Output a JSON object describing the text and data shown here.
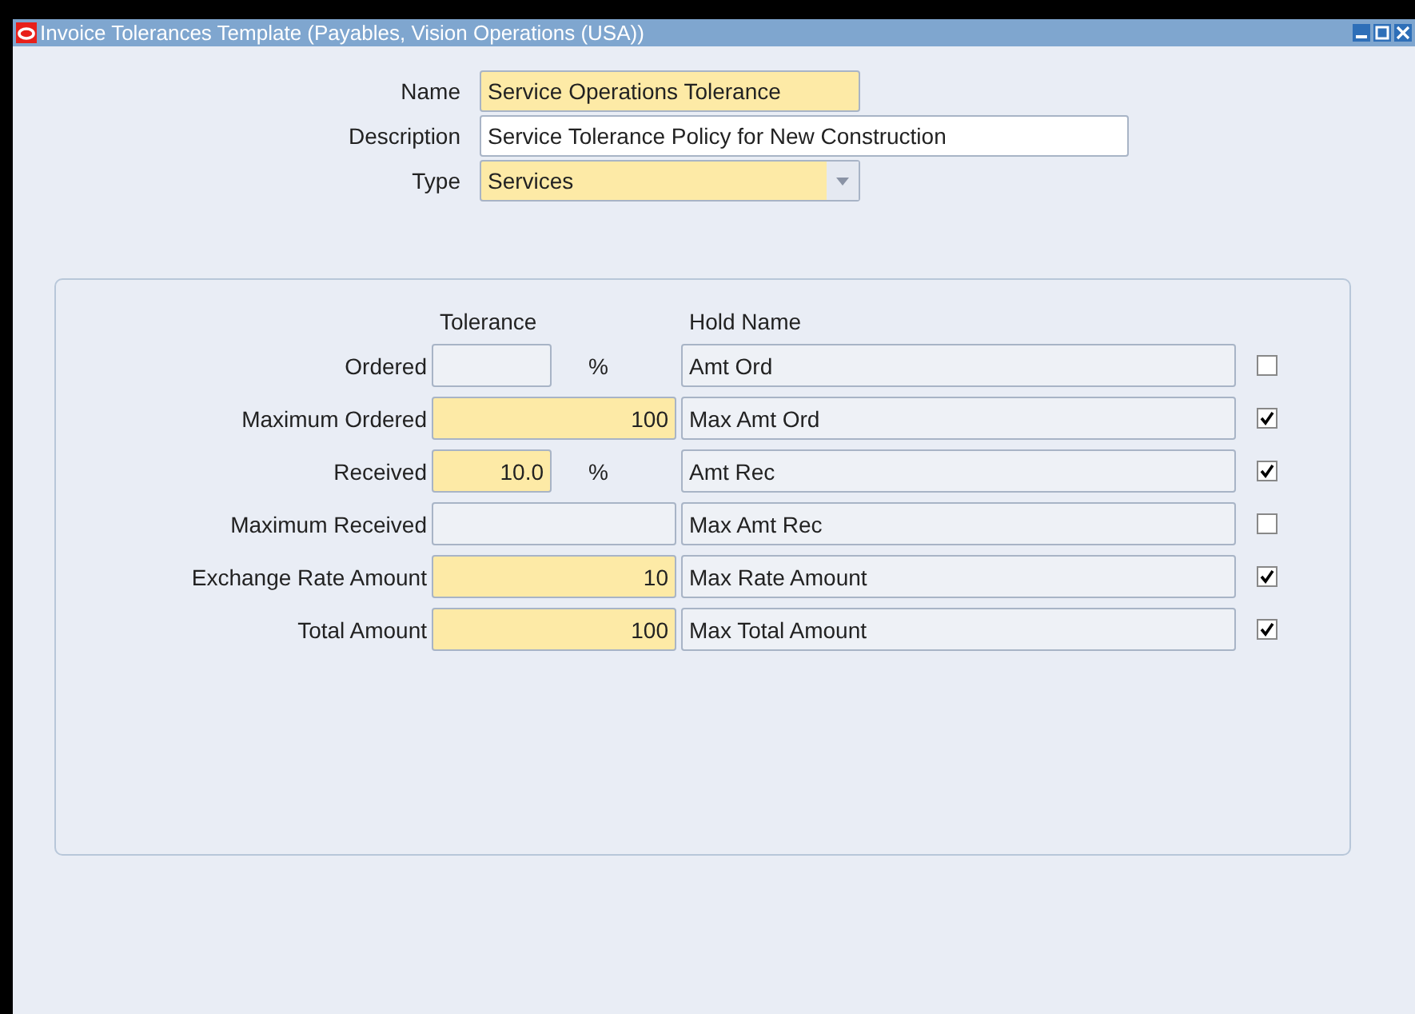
{
  "window": {
    "title": "Invoice Tolerances Template (Payables, Vision Operations (USA))"
  },
  "header_fields": [
    {
      "label": "Name",
      "value": "Service Operations Tolerance",
      "required": true,
      "kind": "text"
    },
    {
      "label": "Description",
      "value": "Service Tolerance Policy for New Construction",
      "required": false,
      "kind": "text"
    },
    {
      "label": "Type",
      "value": "Services",
      "required": true,
      "kind": "select"
    }
  ],
  "columns": [
    "Tolerance",
    "Hold Name"
  ],
  "rows": [
    {
      "label": "Ordered",
      "kind": "percent",
      "tolerance": "",
      "unit": "%",
      "required": false,
      "hold_name": "Amt Ord",
      "checked": false
    },
    {
      "label": "Maximum Ordered",
      "kind": "amount",
      "tolerance": "100",
      "required": true,
      "hold_name": "Max Amt Ord",
      "checked": true
    },
    {
      "label": "Received",
      "kind": "percent",
      "tolerance": "10.0",
      "unit": "%",
      "required": true,
      "hold_name": "Amt Rec",
      "checked": true
    },
    {
      "label": "Maximum Received",
      "kind": "amount",
      "tolerance": "",
      "required": false,
      "hold_name": "Max Amt Rec",
      "checked": false
    },
    {
      "label": "Exchange Rate Amount",
      "kind": "amount",
      "tolerance": "10",
      "required": true,
      "hold_name": "Max Rate Amount",
      "checked": true
    },
    {
      "label": "Total Amount",
      "kind": "amount",
      "tolerance": "100",
      "required": true,
      "hold_name": "Max Total Amount",
      "checked": true
    }
  ]
}
